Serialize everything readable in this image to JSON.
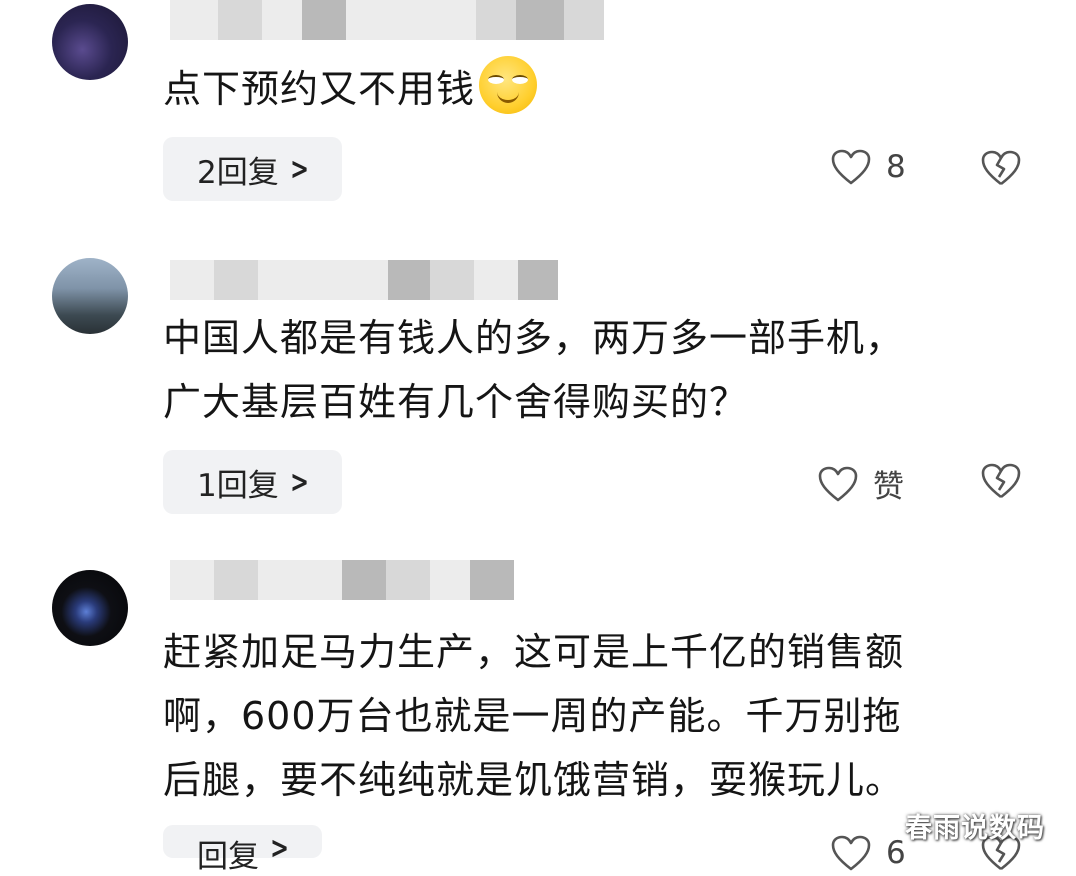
{
  "comments": [
    {
      "text_lines": [
        "点下预约又不用钱"
      ],
      "emoji": "smirk-face-icon",
      "reply_label": "2回复",
      "likes": "8"
    },
    {
      "text_lines": [
        "中国人都是有钱人的多，两万多一部手机，",
        "广大基层百姓有几个舍得购买的？"
      ],
      "reply_label": "1回复",
      "likes": "赞"
    },
    {
      "text_lines": [
        "赶紧加足马力生产，这可是上千亿的销售额",
        "啊，600万台也就是一周的产能。千万别拖",
        "后腿，要不纯纯就是饥饿营销，耍猴玩儿。"
      ],
      "reply_label": "回复",
      "likes": "6"
    }
  ],
  "watermark": "春雨说数码",
  "colors": {
    "reply_bg": "#f1f2f4",
    "icon_stroke": "#555555",
    "text": "#151515"
  }
}
